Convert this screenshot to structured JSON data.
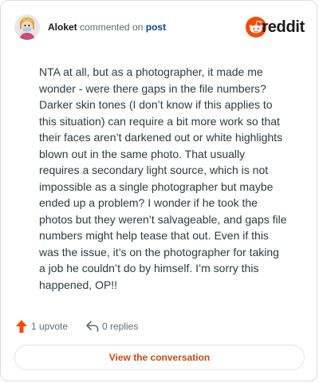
{
  "comment": {
    "author": "Aloket",
    "action_text": "commented on",
    "target_link": "post",
    "body": "NTA at all, but as a photographer, it made me wonder - were there gaps in the file numbers? Darker skin tones (I don’t know if this applies to this situation) can require a bit more work so that their faces aren’t darkened out or white highlights blown out in the same photo. That usually requires a secondary light source, which is not impossible as a single photographer but maybe ended up a problem? I wonder if he took the photos but they weren’t salvageable, and gaps file numbers might help tease that out. Even if this was the issue, it’s on the photographer for taking a job he couldn’t do by himself. I’m sorry this happened, OP!!"
  },
  "brand": {
    "name": "reddit",
    "icon": "reddit-logo-icon",
    "color": "#ff4500"
  },
  "actions": {
    "upvotes": "1 upvote",
    "upvote_icon": "upvote-arrow-icon",
    "upvote_color": "#ff4500",
    "replies": "0 replies",
    "reply_icon": "reply-arrow-icon"
  },
  "cta": {
    "label": "View the conversation",
    "color": "#c44a14"
  },
  "avatar_icon": "user-avatar-icon"
}
